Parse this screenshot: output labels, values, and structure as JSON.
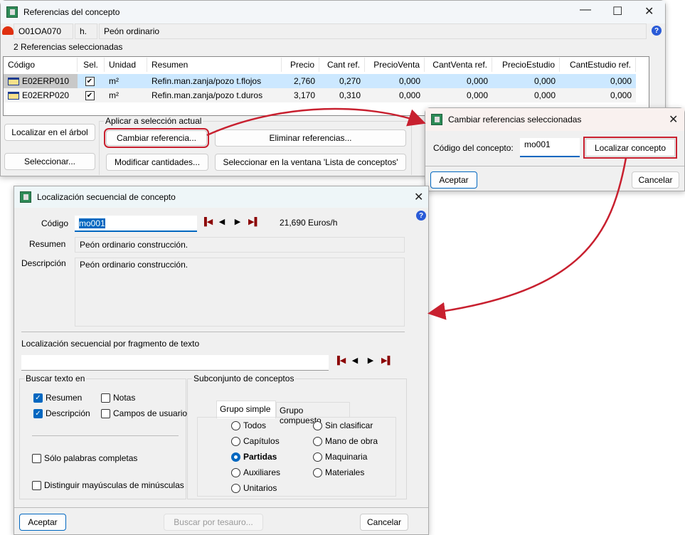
{
  "win_refs": {
    "title": "Referencias del concepto",
    "code": "O01OA070",
    "unit": "h.",
    "name": "Peón ordinario",
    "selected_count": "2  Referencias seleccionadas",
    "columns": [
      "Código",
      "Sel.",
      "Unidad",
      "Resumen",
      "Precio",
      "Cant ref.",
      "PrecioVenta",
      "CantVenta ref.",
      "PrecioEstudio",
      "CantEstudio ref."
    ],
    "rows": [
      {
        "codigo": "E02ERP010",
        "sel": true,
        "unidad": "m²",
        "resumen": "Refin.man.zanja/pozo t.flojos",
        "precio": "2,760",
        "cant": "0,270",
        "pv": "0,000",
        "cv": "0,000",
        "pe": "0,000",
        "ce": "0,000"
      },
      {
        "codigo": "E02ERP020",
        "sel": true,
        "unidad": "m²",
        "resumen": "Refin.man.zanja/pozo t.duros",
        "precio": "3,170",
        "cant": "0,310",
        "pv": "0,000",
        "cv": "0,000",
        "pe": "0,000",
        "ce": "0,000"
      }
    ],
    "btn_locate_tree": "Localizar en el árbol",
    "btn_select": "Seleccionar...",
    "group_label": "Aplicar a selección actual",
    "btn_change": "Cambiar referencia...",
    "btn_delete": "Eliminar referencias...",
    "btn_modify": "Modificar cantidades...",
    "btn_select_list": "Seleccionar en la ventana 'Lista de conceptos'"
  },
  "win_change": {
    "title": "Cambiar referencias seleccionadas",
    "label": "Código del concepto:",
    "value": "mo001",
    "btn_locate": "Localizar concepto",
    "btn_ok": "Aceptar",
    "btn_cancel": "Cancelar"
  },
  "win_locate": {
    "title": "Localización secuencial de concepto",
    "code_label": "Código",
    "code_value": "mo001",
    "price": "21,690 Euros/h",
    "resumen_label": "Resumen",
    "resumen": "Peón ordinario construcción.",
    "desc_label": "Descripción",
    "desc": "Peón ordinario construcción.",
    "fragment_label": "Localización secuencial por fragmento de texto",
    "fragment_value": "",
    "search_group": "Buscar texto en",
    "cb_resumen": "Resumen",
    "cb_notas": "Notas",
    "cb_desc": "Descripción",
    "cb_campos": "Campos de usuario",
    "cb_whole": "Sólo palabras completas",
    "cb_case": "Distinguir mayúsculas de minúsculas",
    "subset_group": "Subconjunto de conceptos",
    "tab_simple": "Grupo simple",
    "tab_compound": "Grupo compuesto",
    "radios": [
      "Todos",
      "Capítulos",
      "Partidas",
      "Auxiliares",
      "Unitarios",
      "Sin clasificar",
      "Mano de obra",
      "Maquinaria",
      "Materiales"
    ],
    "radio_selected": "Partidas",
    "btn_ok": "Aceptar",
    "btn_thesaurus": "Buscar por tesauro...",
    "btn_cancel": "Cancelar"
  },
  "colors": {
    "accent": "#0067c0",
    "highlight": "#c8202f",
    "selected_row": "#cce8ff"
  }
}
